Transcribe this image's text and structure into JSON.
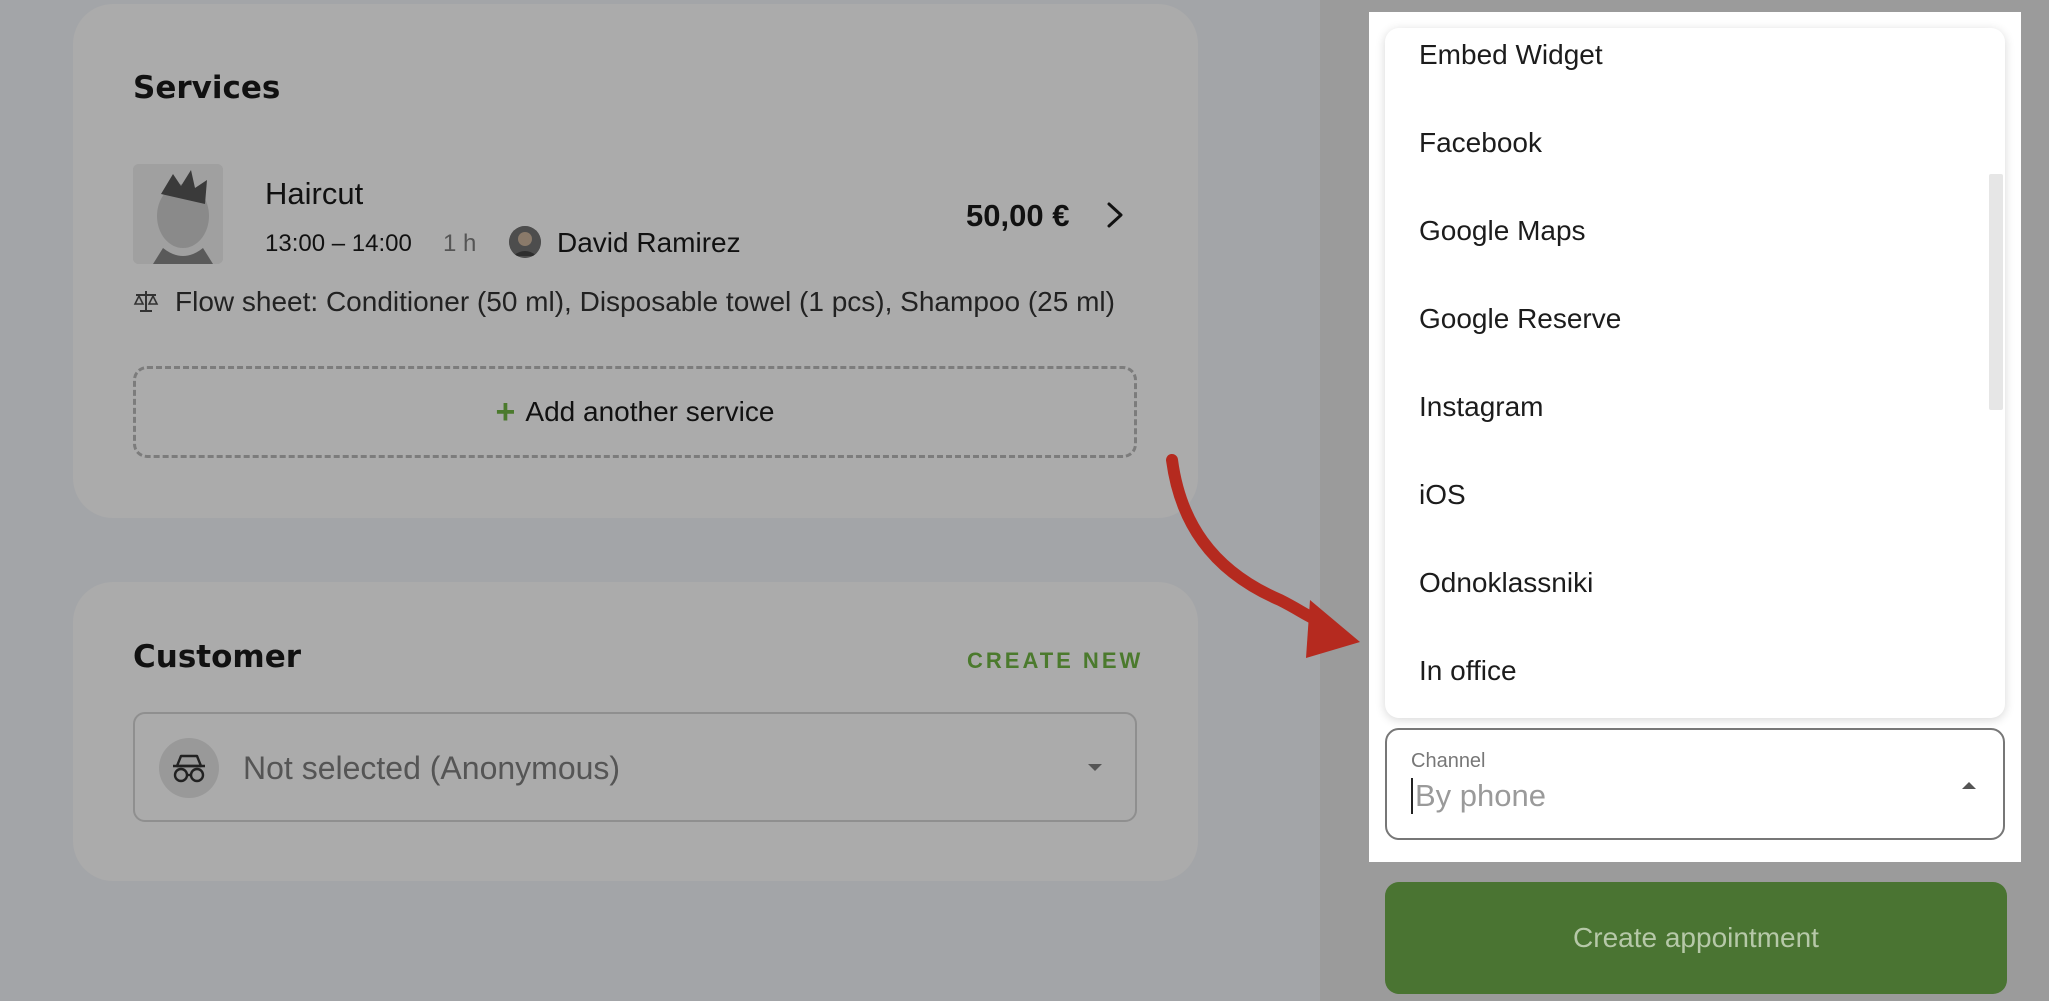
{
  "services": {
    "title": "Services",
    "item": {
      "name": "Haircut",
      "time": "13:00 – 14:00",
      "duration": "1 h",
      "staff": "David Ramirez",
      "price": "50,00 €",
      "flow_sheet": "Flow sheet: Conditioner (50 ml), Disposable towel (1 pcs), Shampoo (25 ml)"
    },
    "add_label": "Add another service"
  },
  "customer": {
    "title": "Customer",
    "create_new": "CREATE NEW",
    "value": "Not selected (Anonymous)"
  },
  "channel": {
    "label": "Channel",
    "value": "By phone",
    "options": [
      "Embed Widget",
      "Facebook",
      "Google Maps",
      "Google Reserve",
      "Instagram",
      "iOS",
      "Odnoklassniki",
      "In office"
    ]
  },
  "create_button": "Create appointment",
  "colors": {
    "accent": "#4b7a2d",
    "button": "#4a7432",
    "arrow": "#b52a1f"
  }
}
